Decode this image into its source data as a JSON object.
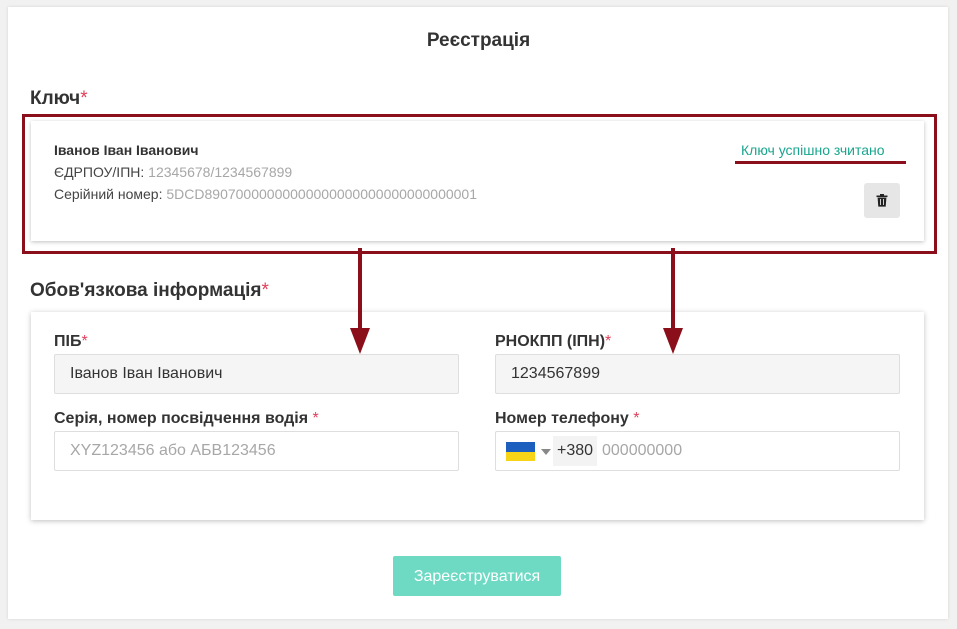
{
  "page": {
    "title": "Реєстрація"
  },
  "key_section": {
    "title": "Ключ",
    "required_mark": "*",
    "owner_name": "Іванов Іван Іванович",
    "edrpou_label": "ЄДРПОУ/ІПН:",
    "edrpou_value": "12345678/1234567899",
    "serial_label": "Серійний номер:",
    "serial_value": "5DCD89070000000000000000000000000000001",
    "status": "Ключ успішно зчитано",
    "delete_icon": "trash-icon"
  },
  "info_section": {
    "title": "Обов'язкова інформація",
    "required_mark": "*",
    "pib": {
      "label": "ПІБ",
      "required_mark": "*",
      "value": "Іванов Іван Іванович"
    },
    "rnokpp": {
      "label": "РНОКПП (ІПН)",
      "required_mark": "*",
      "value": "1234567899"
    },
    "license": {
      "label": "Серія, номер посвідчення водія ",
      "required_mark": "*",
      "placeholder": "XYZ123456 або АБВ123456"
    },
    "phone": {
      "label": "Номер телефону ",
      "required_mark": "*",
      "dial_code": "+380",
      "placeholder": "000000000",
      "flag_icon": "ukraine-flag-icon"
    }
  },
  "submit": {
    "label": "Зареєструватися"
  },
  "colors": {
    "accent": "#6fdac4",
    "status_text": "#1aa58e",
    "required": "#e0405a",
    "annotation": "#8b0f1a"
  }
}
